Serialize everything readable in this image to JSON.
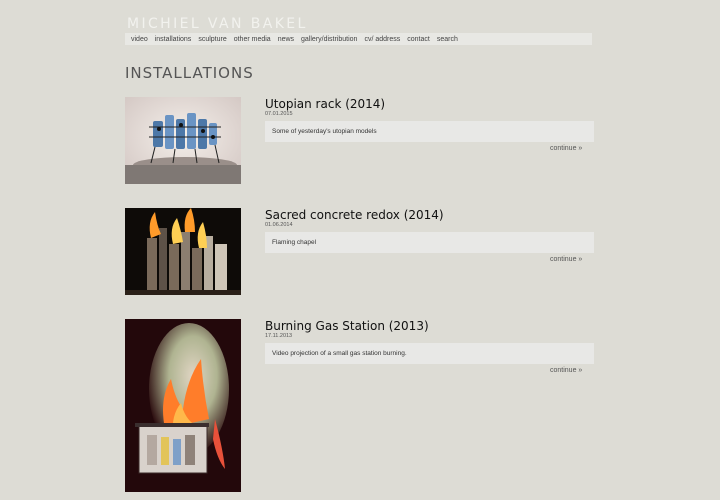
{
  "site": {
    "name": "MICHIEL VAN BAKEL"
  },
  "nav": {
    "items": [
      "video",
      "installations",
      "sculpture",
      "other media",
      "news",
      "gallery/distribution",
      "cv/ address",
      "contact",
      "search"
    ]
  },
  "page": {
    "title": "INSTALLATIONS"
  },
  "entries": [
    {
      "title": "Utopian rack (2014)",
      "date": "07.01.2015",
      "description": "Some of yesterday's utopian models",
      "continue": "continue »"
    },
    {
      "title": "Sacred concrete redox (2014)",
      "date": "01.06.2014",
      "description": "Flaming chapel",
      "continue": "continue »"
    },
    {
      "title": "Burning Gas Station (2013)",
      "date": "17.11.2013",
      "description": "Video projection of a small gas station burning.",
      "continue": "continue »"
    }
  ]
}
